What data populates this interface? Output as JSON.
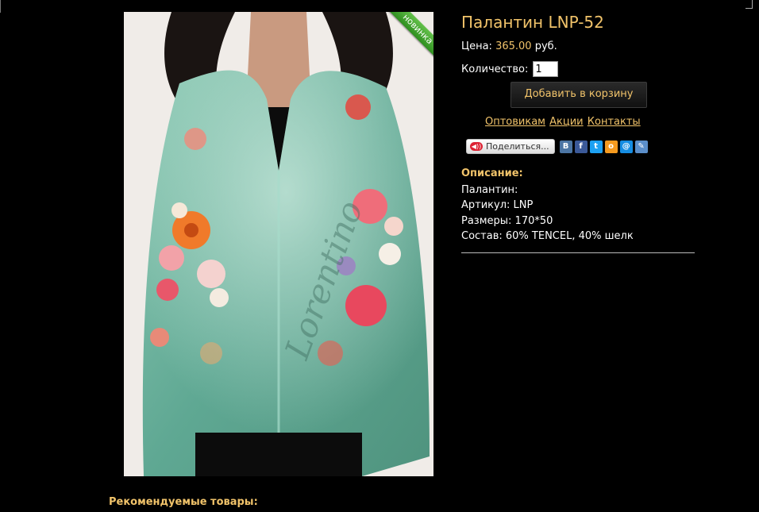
{
  "product": {
    "title": "Палантин LNP-52",
    "badge": "новинка",
    "price_label": "Цена:",
    "price_value": "365.00",
    "currency": "руб.",
    "qty_label": "Количество:",
    "qty_value": "1",
    "add_to_cart": "Добавить в корзину",
    "photo_watermark": "Lorentino"
  },
  "links": [
    "Оптовикам",
    "Акции",
    "Контакты"
  ],
  "share": {
    "button_label": "Поделиться...",
    "icons": [
      {
        "name": "vk-icon",
        "glyph": "В",
        "color": "#4c75a3"
      },
      {
        "name": "facebook-icon",
        "glyph": "f",
        "color": "#3b5998"
      },
      {
        "name": "twitter-icon",
        "glyph": "t",
        "color": "#1da1f2"
      },
      {
        "name": "odnoklassniki-icon",
        "glyph": "o",
        "color": "#f59a1f"
      },
      {
        "name": "mailru-icon",
        "glyph": "@",
        "color": "#168de2"
      },
      {
        "name": "livejournal-icon",
        "glyph": "✎",
        "color": "#5b8ec9"
      }
    ]
  },
  "description": {
    "label": "Описание:",
    "lines": [
      "Палантин:",
      "Артикул: LNP",
      "Размеры: 170*50",
      "Состав: 60% TENCEL, 40% шелк"
    ]
  },
  "recommended_label": "Рекомендуемые товары:",
  "colors": {
    "accent": "#f1c36a",
    "background": "#000000",
    "scarf": "#6fb39e"
  }
}
